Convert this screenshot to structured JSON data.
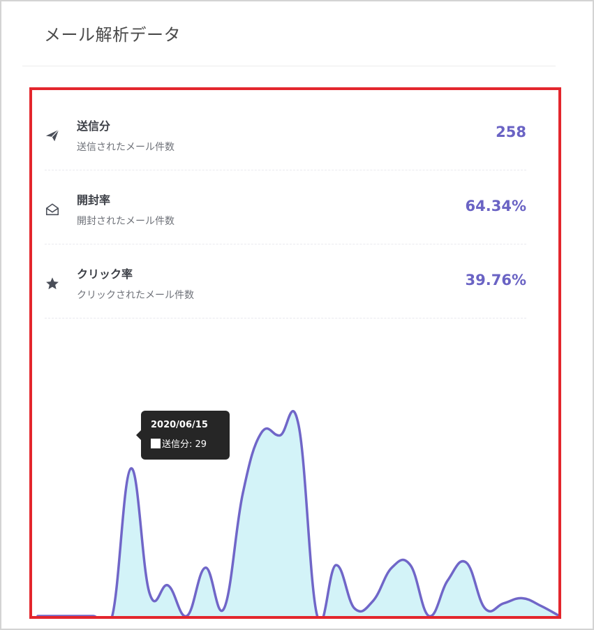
{
  "page": {
    "title": "メール解析データ"
  },
  "stats": [
    {
      "label": "送信分",
      "sublabel": "送信されたメール件数",
      "value": "258",
      "icon": "paper-plane-icon"
    },
    {
      "label": "開封率",
      "sublabel": "開封されたメール件数",
      "value": "64.34%",
      "icon": "open-envelope-icon"
    },
    {
      "label": "クリック率",
      "sublabel": "クリックされたメール件数",
      "value": "39.76%",
      "icon": "star-icon"
    }
  ],
  "colors": {
    "accent": "#6a63c4",
    "line": "#7066c8",
    "fill": "#d3f3f8",
    "highlight_border": "#e3262d",
    "tooltip_bg": "#262626"
  },
  "tooltip": {
    "date": "2020/06/15",
    "series": "送信分",
    "value": 29
  },
  "chart_data": {
    "type": "area",
    "title": "",
    "xlabel": "",
    "ylabel": "",
    "grid": false,
    "ylim": [
      0,
      35
    ],
    "series": [
      {
        "values": [
          0,
          0,
          0,
          0,
          0,
          29,
          4.5,
          6,
          0,
          9.5,
          1.5,
          24,
          36,
          35.5,
          37.5,
          0,
          10,
          1.5,
          3,
          9.5,
          10,
          0,
          7,
          10.5,
          1.5,
          2.5,
          3.5,
          2,
          0
        ]
      }
    ]
  }
}
